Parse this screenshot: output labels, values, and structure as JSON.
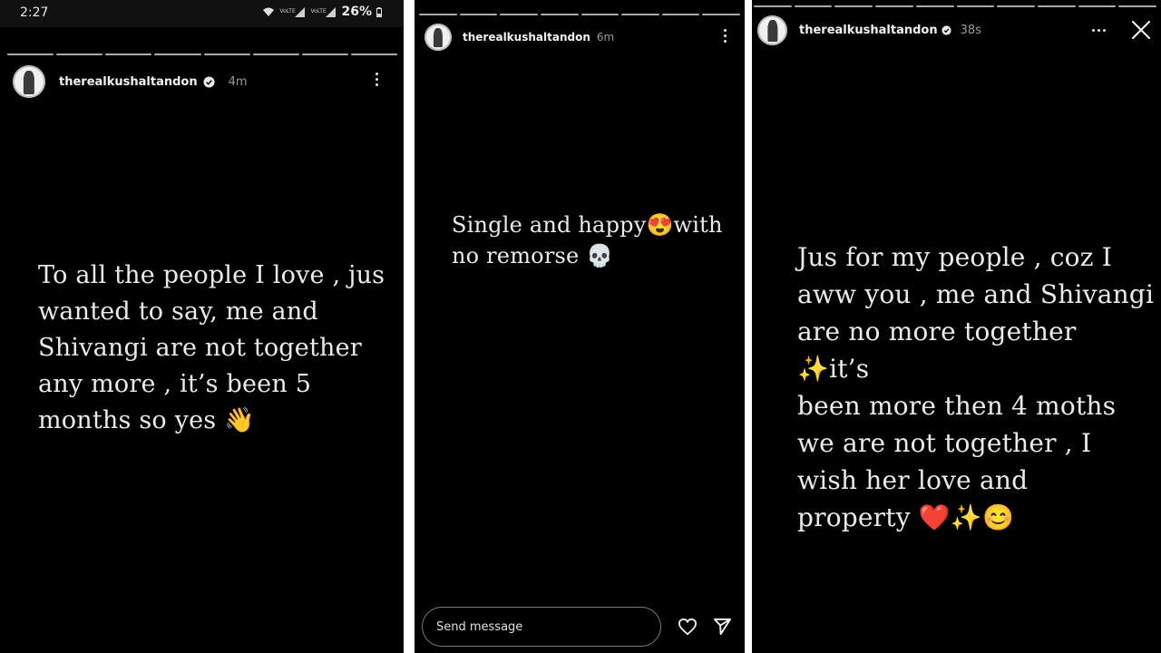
{
  "status_bar": {
    "time": "2:27",
    "battery": "26%",
    "sim1_tag": "VoLTE",
    "sim2_tag": "VoLTE"
  },
  "panels": [
    {
      "username": "therealkushaltandon",
      "time_ago": "4m",
      "verified": true,
      "text": "To all the people I love , jus\nwanted to say, me and\nShivangi are not together\nany more , it’s been 5\nmonths so yes 👋"
    },
    {
      "username": "therealkushaltandon",
      "time_ago": "6m",
      "verified": false,
      "text": "Single and happy😍with\nno remorse 💀",
      "reply_placeholder": "Send message"
    },
    {
      "username": "therealkushaltandon",
      "time_ago": "38s",
      "verified": true,
      "text": "Jus for my people , coz I\naww you , me and Shivangi\nare no more together ✨it’s\nbeen more then 4 moths\nwe are not together , I\nwish her love and\nproperty ❤️✨😊"
    }
  ],
  "icons": [
    "wifi-icon",
    "signal-icon",
    "battery-icon",
    "verified-icon",
    "more-vertical-icon",
    "more-horizontal-icon",
    "close-icon",
    "heart-icon",
    "send-icon"
  ],
  "colors": {
    "background": "#000000",
    "text": "#eaeaea",
    "muted": "#9a9a9a",
    "divider": "#ffffff"
  }
}
